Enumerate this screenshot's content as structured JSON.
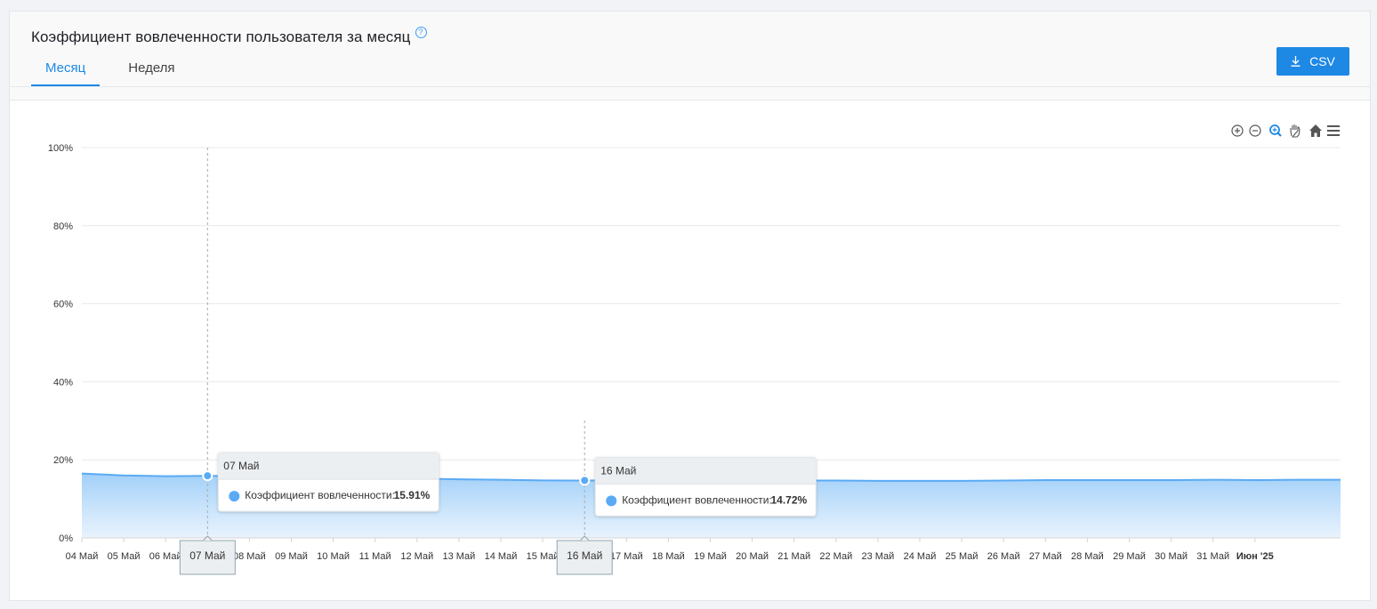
{
  "header": {
    "title": "Коэффициент вовлеченности пользователя за месяц",
    "help_glyph": "?",
    "tabs": [
      {
        "label": "Месяц",
        "active": true
      },
      {
        "label": "Неделя",
        "active": false
      }
    ],
    "csv_label": "CSV"
  },
  "colors": {
    "accent": "#1e88e5",
    "series": "#5aaaf5",
    "grid": "#e8e8e8"
  },
  "toolbar": {
    "icons": [
      "zoom-in-icon",
      "zoom-out-icon",
      "selection-zoom-icon",
      "pan-hand-icon",
      "reset-home-icon",
      "menu-icon"
    ]
  },
  "chart_data": {
    "type": "area",
    "series": [
      {
        "name": "Коэффициент вовлеченности",
        "values": [
          16.5,
          16.0,
          15.8,
          15.91,
          15.8,
          15.6,
          15.5,
          15.3,
          15.2,
          15.0,
          14.9,
          14.72,
          14.7,
          14.8,
          14.8,
          14.8,
          14.7,
          14.7,
          14.7,
          14.6,
          14.6,
          14.6,
          14.7,
          14.8,
          14.8,
          14.8,
          14.8,
          14.9,
          14.8,
          14.9,
          14.9
        ]
      }
    ],
    "x": [
      "04 Май",
      "05 Май",
      "06 Май",
      "07 Май",
      "08 Май",
      "09 Май",
      "10 Май",
      "11 Май",
      "12 Май",
      "13 Май",
      "14 Май",
      "15 Май",
      "16 Май",
      "17 Май",
      "18 Май",
      "19 Май",
      "20 Май",
      "21 Май",
      "22 Май",
      "23 Май",
      "24 Май",
      "25 Май",
      "26 Май",
      "27 Май",
      "28 Май",
      "29 Май",
      "30 Май",
      "31 Май",
      "Июн '25"
    ],
    "y_ticks": [
      "0%",
      "20%",
      "40%",
      "60%",
      "80%",
      "100%"
    ],
    "ylim": [
      0,
      100
    ],
    "grid": true,
    "tooltips": [
      {
        "date": "07 Май",
        "label": "Коэффициент вовлеченности:",
        "value": "15.91%"
      },
      {
        "date": "16 Май",
        "label": "Коэффициент вовлеченности:",
        "value": "14.72%"
      }
    ]
  }
}
